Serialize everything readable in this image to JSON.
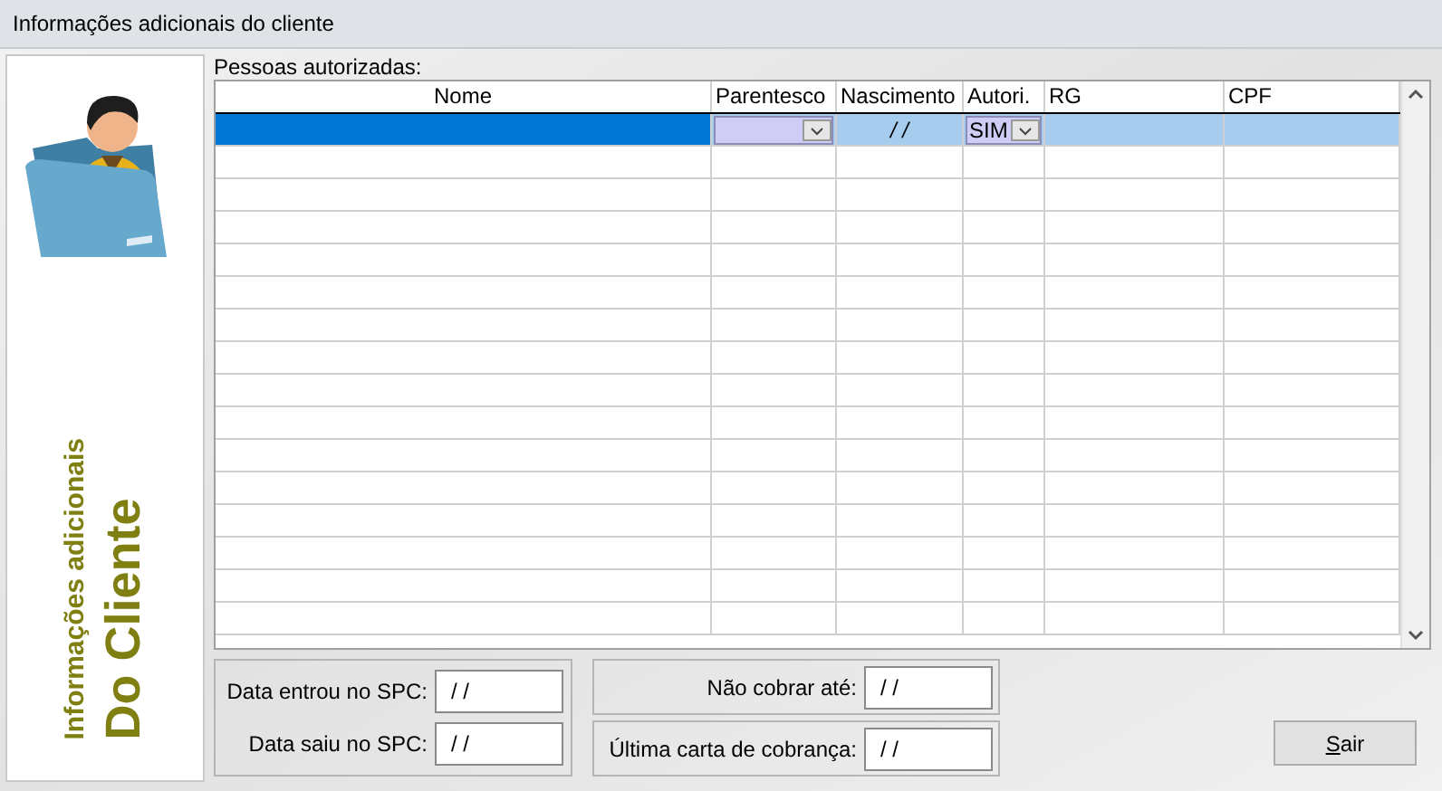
{
  "window": {
    "title": "Informações adicionais do cliente"
  },
  "sidebar": {
    "subtitle": "Informações adicionais",
    "title": "Do Cliente"
  },
  "grid": {
    "label": "Pessoas autorizadas:",
    "columns": [
      {
        "label": "Nome"
      },
      {
        "label": "Parentesco"
      },
      {
        "label": "Nascimento"
      },
      {
        "label": "Autori."
      },
      {
        "label": "RG"
      },
      {
        "label": "CPF"
      }
    ],
    "rows": [
      {
        "selected": true,
        "cells": [
          {
            "kind": "text"
          },
          {
            "kind": "dropdown"
          },
          {
            "kind": "text",
            "value": "/ /"
          },
          {
            "kind": "dropdown",
            "value": "SIM"
          },
          {
            "kind": "text"
          },
          {
            "kind": "text"
          }
        ]
      }
    ]
  },
  "spc_fields": [
    {
      "label": "Data entrou no SPC:",
      "value": "/ /"
    },
    {
      "label": "Data saiu no SPC:",
      "value": "/ /"
    }
  ],
  "billing_fields": [
    {
      "label": "Não cobrar até:",
      "value": "/ /"
    },
    {
      "label": "Última carta de cobrança:",
      "value": "/ /"
    }
  ],
  "buttons": [
    {
      "label": "Sair"
    }
  ]
}
